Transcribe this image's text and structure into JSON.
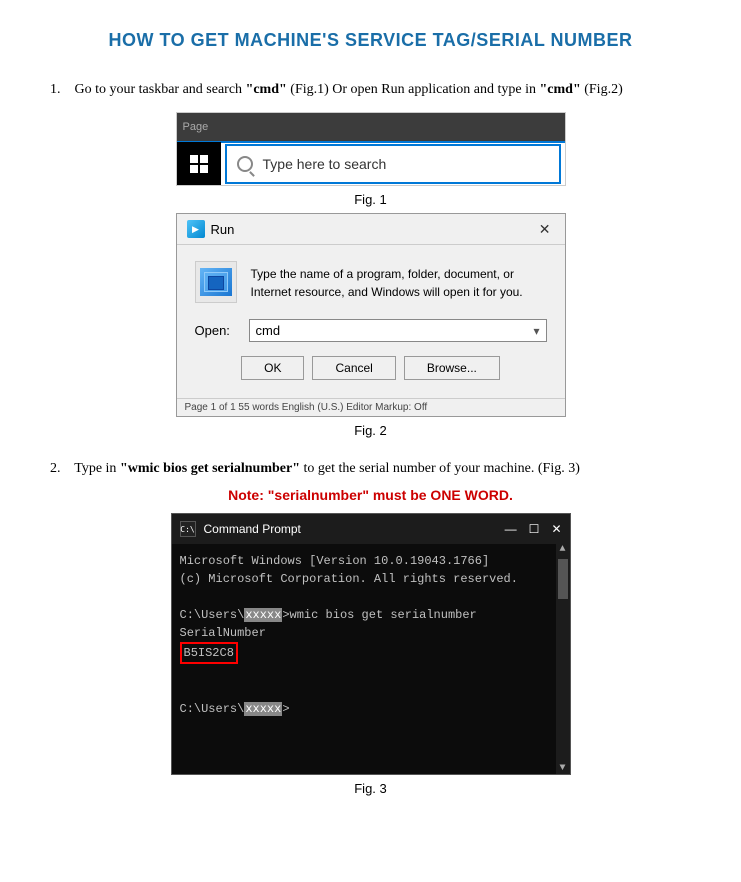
{
  "page": {
    "title": "HOW TO GET MACHINE'S SERVICE TAG/SERIAL NUMBER"
  },
  "step1": {
    "number": "1.",
    "text_before": "Go to your taskbar and search ",
    "bold1": "\"cmd\"",
    "text_mid1": " (Fig.1) Or open Run application and type in ",
    "bold2": "\"cmd\"",
    "text_mid2": " (Fig.2)"
  },
  "fig1": {
    "label": "Fig. 1",
    "page_label": "Page",
    "search_placeholder": "Type here to search"
  },
  "fig2": {
    "label": "Fig. 2",
    "title": "Run",
    "close": "✕",
    "description": "Type the name of a program, folder, document, or Internet resource, and Windows will open it for you.",
    "open_label": "Open:",
    "input_value": "cmd",
    "dropdown_arrow": "▾",
    "btn_ok": "OK",
    "btn_cancel": "Cancel",
    "btn_browse": "Browse...",
    "statusbar": "Page 1 of 1   55 words   English (U.S.)   Editor Markup: Off"
  },
  "step2": {
    "number": "2.",
    "text_before": "Type in ",
    "bold": "\"wmic bios get serialnumber\"",
    "text_after": " to get the serial number of your machine. (Fig. 3)",
    "note": "Note: \"serialnumber\" must be ONE WORD."
  },
  "fig3": {
    "label": "Fig. 3",
    "title": "Command Prompt",
    "icon_text": "C:\\",
    "controls": [
      "—",
      "☐",
      "✕"
    ],
    "lines": [
      "Microsoft Windows [Version 10.0.19043.1766]",
      "(c) Microsoft Corporation. All rights reserved.",
      "",
      "C:\\Users\\xxxxx>wmic bios get serialnumber",
      "SerialNumber",
      "B5IS2C8",
      "",
      "",
      "C:\\Users\\xxxxx>"
    ],
    "highlighted_line": "B5IS2C8"
  }
}
